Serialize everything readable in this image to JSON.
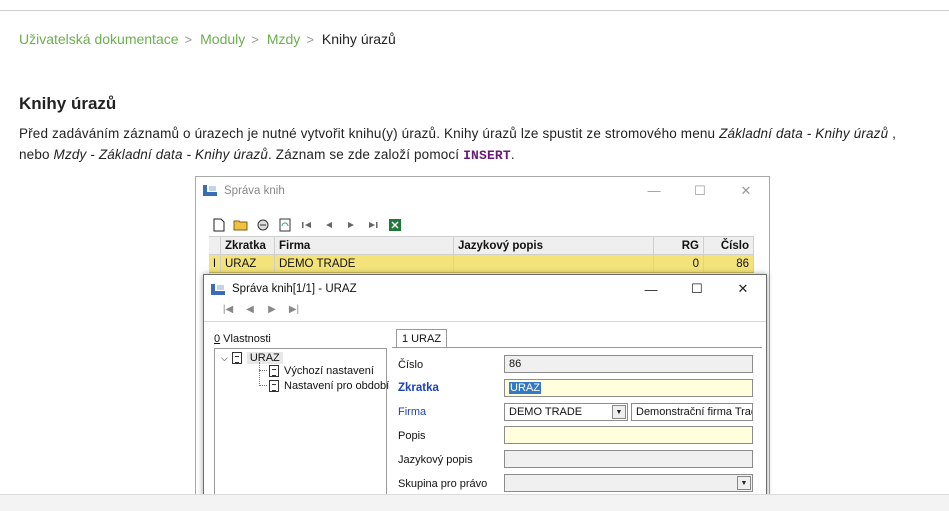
{
  "breadcrumb": {
    "items": [
      "Uživatelská dokumentace",
      "Moduly",
      "Mzdy"
    ],
    "current": "Knihy úrazů",
    "separator": ">"
  },
  "page": {
    "title": "Knihy úrazů",
    "para_1": "Před zadáváním záznamů o úrazech je nutné vytvořit knihu(y) úrazů. Knihy úrazů lze spustit ze stromového menu ",
    "para_2": "Základní data - Knihy úrazů",
    "para_3": " ,",
    "para_4": "nebo ",
    "para_5": "Mzdy - Základní data - Knihy úrazů",
    "para_6": ". Záznam se zde založí pomocí ",
    "para_key": "INSERT",
    "para_7": "."
  },
  "outer_window": {
    "title": "Správa knih",
    "controls": {
      "minimize": "—",
      "maximize": "☐",
      "close": "✕"
    },
    "columns": [
      "Zkratka",
      "Firma",
      "Jazykový popis",
      "RG",
      "Číslo"
    ],
    "row": {
      "marker": "I",
      "zkratka": "URAZ",
      "firma": "DEMO TRADE",
      "jazykovy_popis": "",
      "rg": "0",
      "cislo": "86"
    },
    "row_color": "#f3e37a"
  },
  "inner_window": {
    "title": "Správa knih[1/1] - URAZ",
    "controls": {
      "minimize": "—",
      "maximize": "☐",
      "close": "✕"
    },
    "properties_label_key": "0",
    "properties_label": " Vlastnosti",
    "tree": {
      "root": "URAZ",
      "children": [
        "Výchozí nastavení",
        "Nastavení pro období"
      ]
    },
    "tab": "1 URAZ",
    "fields": {
      "cislo_label": "Číslo",
      "cislo_value": "86",
      "zkratka_label": "Zkratka",
      "zkratka_value": "URAZ",
      "firma_label": "Firma",
      "firma_value": "DEMO TRADE",
      "firma_desc": "Demonstrační firma Trade,",
      "popis_label": "Popis",
      "popis_value": "",
      "jazykovy_label": "Jazykový popis",
      "jazykovy_value": "",
      "skupina_label": "Skupina pro právo",
      "skupina_value": ""
    }
  },
  "icons": [
    "new-doc-icon",
    "open-folder-icon",
    "filter-icon",
    "refresh-icon",
    "first-icon",
    "prev-icon",
    "next-icon",
    "last-icon",
    "excel-icon"
  ]
}
